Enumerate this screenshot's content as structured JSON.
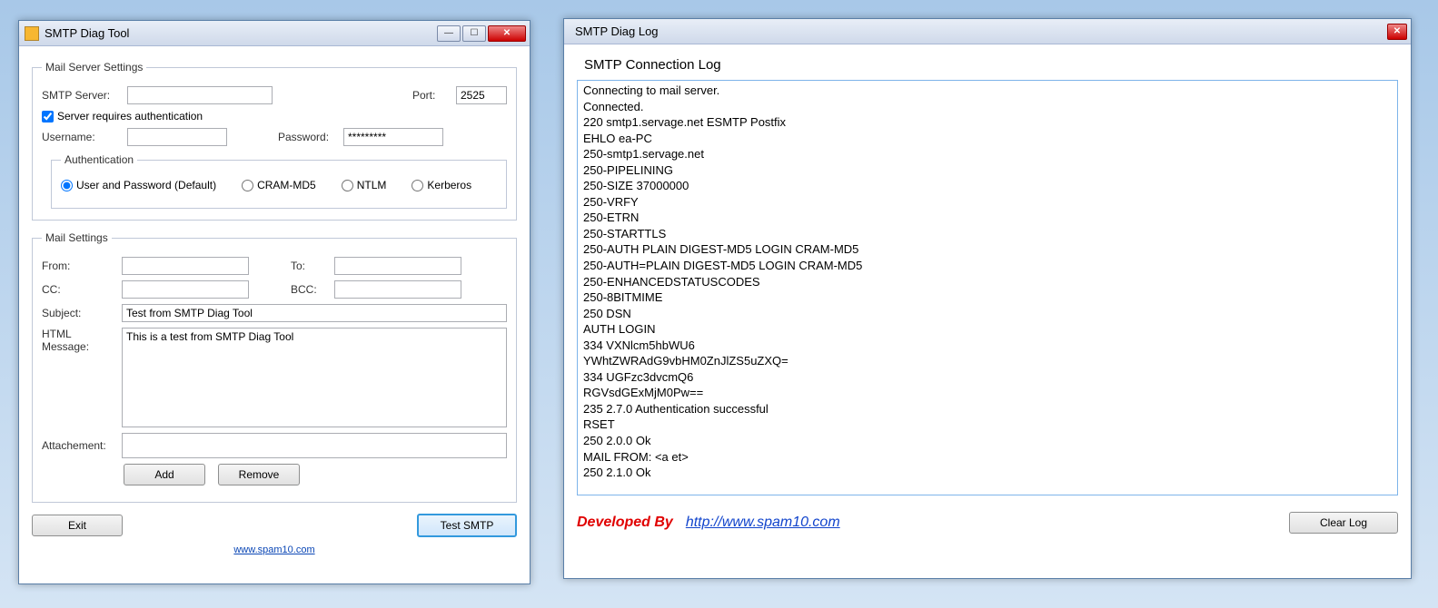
{
  "main": {
    "title": "SMTP Diag Tool",
    "server_group": "Mail Server Settings",
    "smtp_server_label": "SMTP Server:",
    "smtp_server_value": "",
    "port_label": "Port:",
    "port_value": "2525",
    "requires_auth_label": "Server requires authentication",
    "requires_auth_checked": true,
    "username_label": "Username:",
    "username_value": "",
    "password_label": "Password:",
    "password_value": "*********",
    "auth_group": "Authentication",
    "auth_options": {
      "default": "User and Password (Default)",
      "cram": "CRAM-MD5",
      "ntlm": "NTLM",
      "kerberos": "Kerberos"
    },
    "mail_group": "Mail Settings",
    "from_label": "From:",
    "from_value": "",
    "to_label": "To:",
    "to_value": "",
    "cc_label": "CC:",
    "cc_value": "",
    "bcc_label": "BCC:",
    "bcc_value": "",
    "subject_label": "Subject:",
    "subject_value": "Test from SMTP Diag Tool",
    "html_msg_label": "HTML Message:",
    "html_msg_value": "This is a test from SMTP Diag Tool",
    "attachment_label": "Attachement:",
    "attachment_value": "",
    "add_btn": "Add",
    "remove_btn": "Remove",
    "exit_btn": "Exit",
    "test_btn": "Test SMTP",
    "footer_link": "www.spam10.com"
  },
  "log": {
    "title": "SMTP Diag Log",
    "heading": "SMTP Connection Log",
    "lines": "Connecting to mail server.\nConnected.\n220 smtp1.servage.net ESMTP Postfix\nEHLO ea-PC\n250-smtp1.servage.net\n250-PIPELINING\n250-SIZE 37000000\n250-VRFY\n250-ETRN\n250-STARTTLS\n250-AUTH PLAIN DIGEST-MD5 LOGIN CRAM-MD5\n250-AUTH=PLAIN DIGEST-MD5 LOGIN CRAM-MD5\n250-ENHANCEDSTATUSCODES\n250-8BITMIME\n250 DSN\nAUTH LOGIN\n334 VXNlcm5hbWU6\nYWhtZWRAdG9vbHM0ZnJlZS5uZXQ=\n334 UGFzc3dvcmQ6\nRGVsdGExMjM0Pw==\n235 2.7.0 Authentication successful\nRSET\n250 2.0.0 Ok\nMAIL FROM: <a                          et>\n250 2.1.0 Ok",
    "dev_by": "Developed By",
    "dev_link": "http://www.spam10.com",
    "clear_btn": "Clear Log"
  }
}
